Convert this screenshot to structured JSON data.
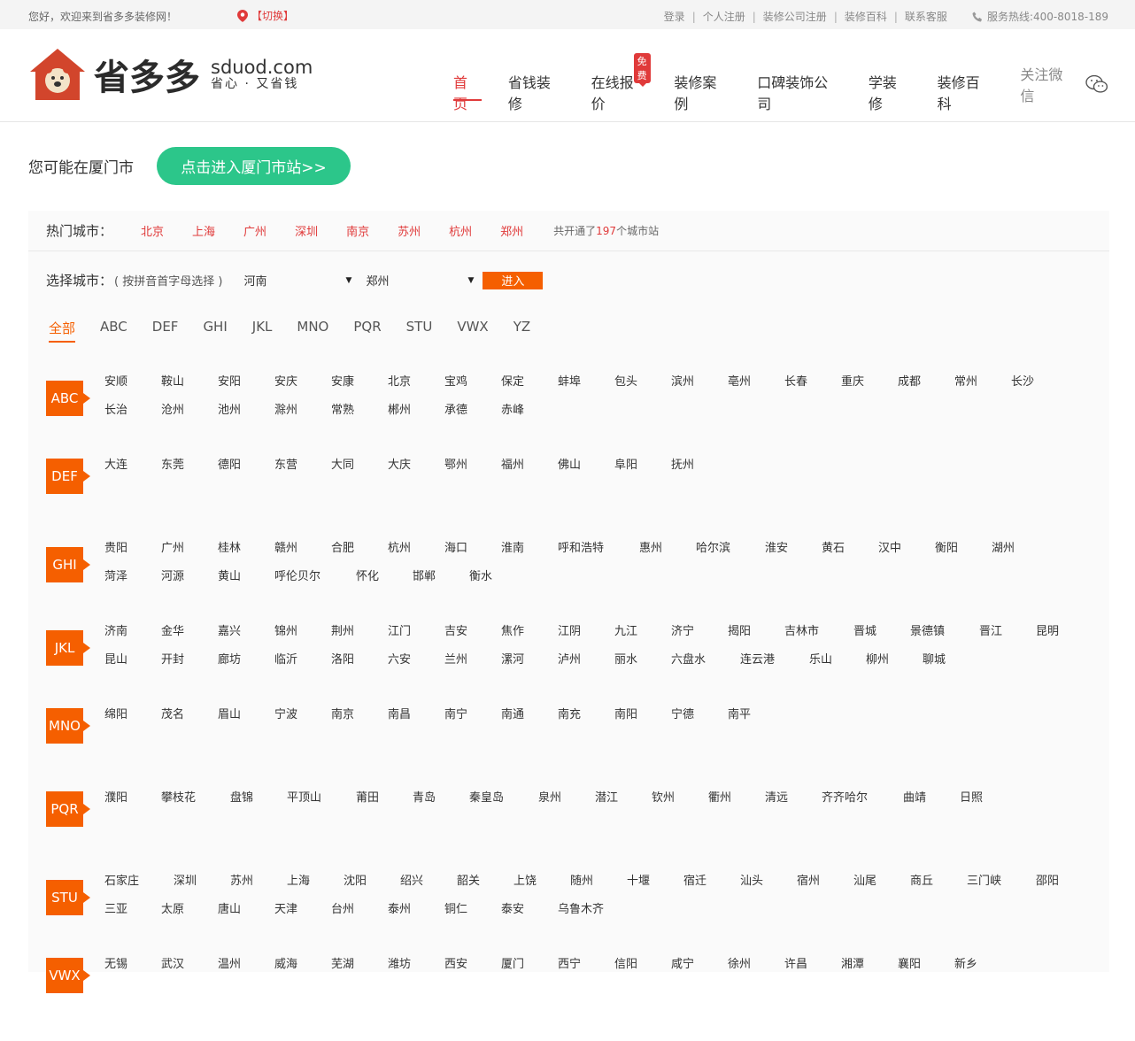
{
  "topbar": {
    "welcome": "您好，欢迎来到省多多装修网！",
    "switch_label": "【切换】",
    "links": [
      "登录",
      "个人注册",
      "装修公司注册",
      "装修百科",
      "联系客服"
    ],
    "hotline": "服务热线:400-8018-189"
  },
  "logo": {
    "brand": "省多多",
    "domain": "sduod.com",
    "slogan": "省心 · 又省钱"
  },
  "nav": {
    "items": [
      "首页",
      "省钱装修",
      "在线报价",
      "装修案例",
      "口碑装饰公司",
      "学装修",
      "装修百科"
    ],
    "badge": "免费",
    "wechat": "关注微信"
  },
  "location": {
    "text": "您可能在厦门市",
    "button": "点击进入厦门市站>>"
  },
  "hot": {
    "label": "热门城市：",
    "cities": [
      "北京",
      "上海",
      "广州",
      "深圳",
      "南京",
      "苏州",
      "杭州",
      "郑州"
    ],
    "count_prefix": "共开通了",
    "count": "197",
    "count_suffix": "个城市站"
  },
  "select": {
    "label": "选择城市：",
    "hint": "( 按拼音首字母选择 )",
    "province": "河南",
    "city": "郑州",
    "go": "进入"
  },
  "letter_tabs": [
    "全部",
    "ABC",
    "DEF",
    "GHI",
    "JKL",
    "MNO",
    "PQR",
    "STU",
    "VWX",
    "YZ"
  ],
  "groups": [
    {
      "tag": "ABC",
      "cities": [
        "安顺",
        "鞍山",
        "安阳",
        "安庆",
        "安康",
        "北京",
        "宝鸡",
        "保定",
        "蚌埠",
        "包头",
        "滨州",
        "亳州",
        "长春",
        "重庆",
        "成都",
        "常州",
        "长沙",
        "长治",
        "沧州",
        "池州",
        "滁州",
        "常熟",
        "郴州",
        "承德",
        "赤峰"
      ]
    },
    {
      "tag": "DEF",
      "cities": [
        "大连",
        "东莞",
        "德阳",
        "东营",
        "大同",
        "大庆",
        "鄂州",
        "福州",
        "佛山",
        "阜阳",
        "抚州"
      ]
    },
    {
      "tag": "GHI",
      "cities": [
        "贵阳",
        "广州",
        "桂林",
        "赣州",
        "合肥",
        "杭州",
        "海口",
        "淮南",
        "呼和浩特",
        "惠州",
        "哈尔滨",
        "淮安",
        "黄石",
        "汉中",
        "衡阳",
        "湖州",
        "菏泽",
        "河源",
        "黄山",
        "呼伦贝尔",
        "怀化",
        "邯郸",
        "衡水"
      ]
    },
    {
      "tag": "JKL",
      "cities": [
        "济南",
        "金华",
        "嘉兴",
        "锦州",
        "荆州",
        "江门",
        "吉安",
        "焦作",
        "江阴",
        "九江",
        "济宁",
        "揭阳",
        "吉林市",
        "晋城",
        "景德镇",
        "晋江",
        "昆明",
        "昆山",
        "开封",
        "廊坊",
        "临沂",
        "洛阳",
        "六安",
        "兰州",
        "漯河",
        "泸州",
        "丽水",
        "六盘水",
        "连云港",
        "乐山",
        "柳州",
        "聊城"
      ]
    },
    {
      "tag": "MNO",
      "cities": [
        "绵阳",
        "茂名",
        "眉山",
        "宁波",
        "南京",
        "南昌",
        "南宁",
        "南通",
        "南充",
        "南阳",
        "宁德",
        "南平"
      ]
    },
    {
      "tag": "PQR",
      "cities": [
        "濮阳",
        "攀枝花",
        "盘锦",
        "平顶山",
        "莆田",
        "青岛",
        "秦皇岛",
        "泉州",
        "潜江",
        "钦州",
        "衢州",
        "清远",
        "齐齐哈尔",
        "曲靖",
        "日照"
      ]
    },
    {
      "tag": "STU",
      "cities": [
        "石家庄",
        "深圳",
        "苏州",
        "上海",
        "沈阳",
        "绍兴",
        "韶关",
        "上饶",
        "随州",
        "十堰",
        "宿迁",
        "汕头",
        "宿州",
        "汕尾",
        "商丘",
        "三门峡",
        "邵阳",
        "三亚",
        "太原",
        "唐山",
        "天津",
        "台州",
        "泰州",
        "铜仁",
        "泰安",
        "乌鲁木齐"
      ]
    },
    {
      "tag": "VWX",
      "cities": [
        "无锡",
        "武汉",
        "温州",
        "威海",
        "芜湖",
        "潍坊",
        "西安",
        "厦门",
        "西宁",
        "信阳",
        "咸宁",
        "徐州",
        "许昌",
        "湘潭",
        "襄阳",
        "新乡"
      ]
    }
  ]
}
